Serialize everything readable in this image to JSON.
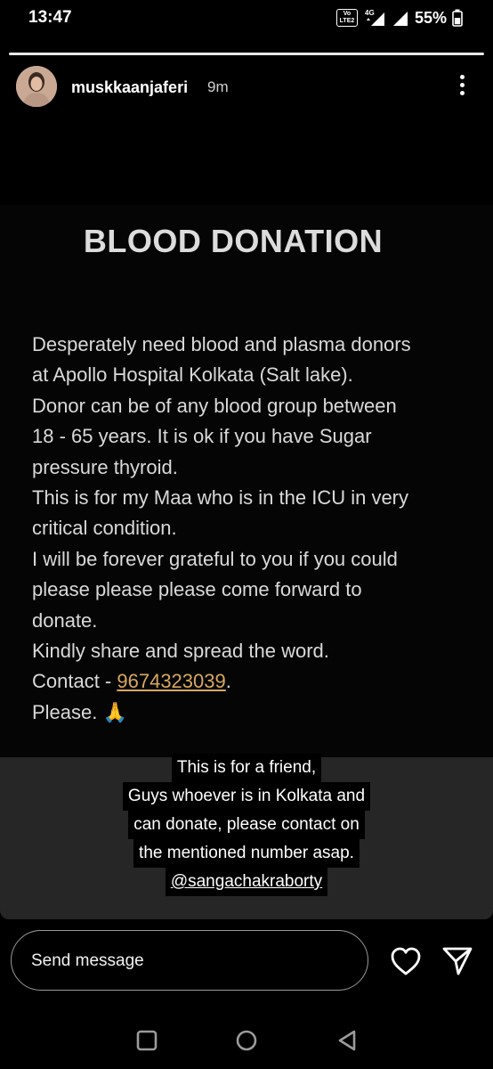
{
  "status_bar": {
    "time": "13:47",
    "volte_label": "Vo LTE2",
    "network": "4G",
    "battery": "55%"
  },
  "story": {
    "progress": 1.0,
    "username": "muskkaanjaferi",
    "time_ago": "9m",
    "post": {
      "title": "BLOOD DONATION",
      "lines": [
        "Desperately need blood and plasma donors",
        "at Apollo Hospital Kolkata (Salt lake).",
        "Donor can be of any blood group between",
        "18 - 65 years. It is ok if you have Sugar",
        "pressure thyroid.",
        "This is for my Maa who is in the ICU in very",
        "critical condition.",
        "I will be forever grateful to you if you could",
        "please please please come forward to",
        "donate.",
        "Kindly share and spread the word."
      ],
      "contact_prefix": "Contact - ",
      "contact_number": "9674323039",
      "contact_suffix": ".",
      "please": "Please. 🙏"
    },
    "caption": {
      "lines": [
        "This is for a friend,",
        "Guys whoever is in Kolkata and",
        "can donate, please contact on",
        "the mentioned number asap."
      ],
      "mention": "@sangachakraborty"
    }
  },
  "bottom_bar": {
    "message_placeholder": "Send message"
  },
  "icons": [
    "more-vertical-icon",
    "heart-icon",
    "send-icon",
    "nav-recents-icon",
    "nav-home-icon",
    "nav-back-icon"
  ],
  "colors": {
    "background": "#000000",
    "link": "#d7a85d",
    "panel": "#262626"
  }
}
